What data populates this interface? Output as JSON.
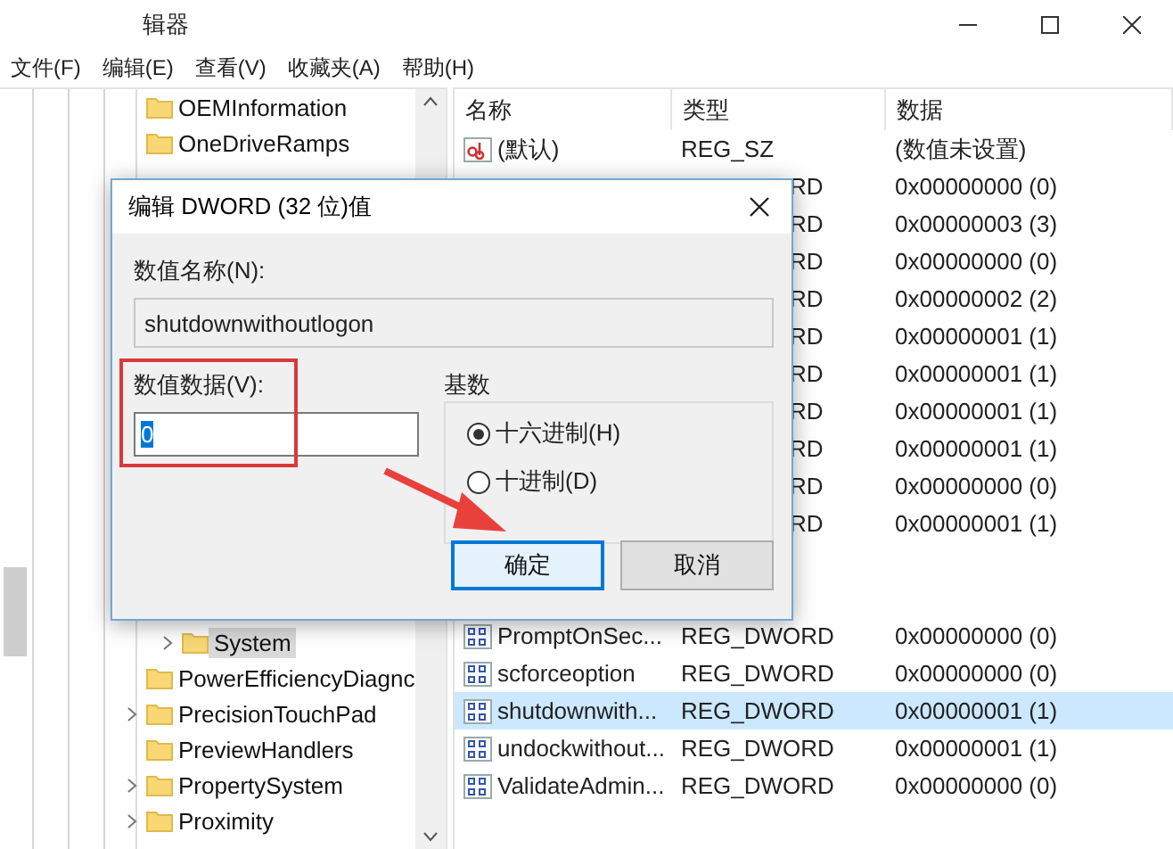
{
  "window": {
    "title": "辑器"
  },
  "menu": [
    {
      "label": "文件(F)"
    },
    {
      "label": "编辑(E)"
    },
    {
      "label": "查看(V)"
    },
    {
      "label": "收藏夹(A)"
    },
    {
      "label": "帮助(H)"
    }
  ],
  "tree": {
    "items_top": [
      {
        "label": "OEMInformation",
        "expandable": false,
        "selected": false
      },
      {
        "label": "OneDriveRamps",
        "expandable": false,
        "selected": false
      }
    ],
    "covered_parent_children": [
      {
        "label": "System",
        "expandable": true,
        "selected": true
      }
    ],
    "items_bottom": [
      {
        "label": "PowerEfficiencyDiagnc",
        "expandable": false,
        "selected": false
      },
      {
        "label": "PrecisionTouchPad",
        "expandable": true,
        "selected": false
      },
      {
        "label": "PreviewHandlers",
        "expandable": false,
        "selected": false
      },
      {
        "label": "PropertySystem",
        "expandable": true,
        "selected": false
      },
      {
        "label": "Proximity",
        "expandable": true,
        "selected": false
      }
    ]
  },
  "list": {
    "columns": [
      "名称",
      "类型",
      "数据"
    ],
    "rows_top": [
      {
        "kind": "string",
        "name": "(默认)",
        "type": "REG_SZ",
        "data": "(数值未设置)",
        "covered": false,
        "selected": false
      },
      {
        "type": "RD",
        "data": "0x00000000 (0)",
        "covered": true,
        "selected": false
      },
      {
        "type": "RD",
        "data": "0x00000003 (3)",
        "covered": true,
        "selected": false
      },
      {
        "type": "RD",
        "data": "0x00000000 (0)",
        "covered": true,
        "selected": false
      },
      {
        "type": "RD",
        "data": "0x00000002 (2)",
        "covered": true,
        "selected": false
      },
      {
        "type": "RD",
        "data": "0x00000001 (1)",
        "covered": true,
        "selected": false
      },
      {
        "type": "RD",
        "data": "0x00000001 (1)",
        "covered": true,
        "selected": false
      },
      {
        "type": "RD",
        "data": "0x00000001 (1)",
        "covered": true,
        "selected": false
      },
      {
        "type": "RD",
        "data": "0x00000001 (1)",
        "covered": true,
        "selected": false
      },
      {
        "type": "RD",
        "data": "0x00000000 (0)",
        "covered": true,
        "selected": false
      },
      {
        "type": "RD",
        "data": "0x00000001 (1)",
        "covered": true,
        "selected": false
      }
    ],
    "rows_bottom": [
      {
        "kind": "dword",
        "name": "PromptOnSec...",
        "type": "REG_DWORD",
        "data": "0x00000000 (0)",
        "covered": false,
        "selected": false
      },
      {
        "kind": "dword",
        "name": "scforceoption",
        "type": "REG_DWORD",
        "data": "0x00000000 (0)",
        "covered": false,
        "selected": false
      },
      {
        "kind": "dword",
        "name": "shutdownwith...",
        "type": "REG_DWORD",
        "data": "0x00000001 (1)",
        "covered": false,
        "selected": true
      },
      {
        "kind": "dword",
        "name": "undockwithout...",
        "type": "REG_DWORD",
        "data": "0x00000001 (1)",
        "covered": false,
        "selected": false
      },
      {
        "kind": "dword",
        "name": "ValidateAdmin...",
        "type": "REG_DWORD",
        "data": "0x00000000 (0)",
        "covered": false,
        "selected": false
      }
    ]
  },
  "dialog": {
    "title": "编辑 DWORD (32 位)值",
    "name_label": "数值名称(N):",
    "name_value": "shutdownwithoutlogon",
    "data_label": "数值数据(V):",
    "data_value": "0",
    "data_value_selected": true,
    "base_label": "基数",
    "base_options": [
      {
        "label": "十六进制(H)",
        "selected": true
      },
      {
        "label": "十进制(D)",
        "selected": false
      }
    ],
    "buttons": [
      {
        "label": "确定",
        "default": true
      },
      {
        "label": "取消",
        "default": false
      }
    ]
  }
}
